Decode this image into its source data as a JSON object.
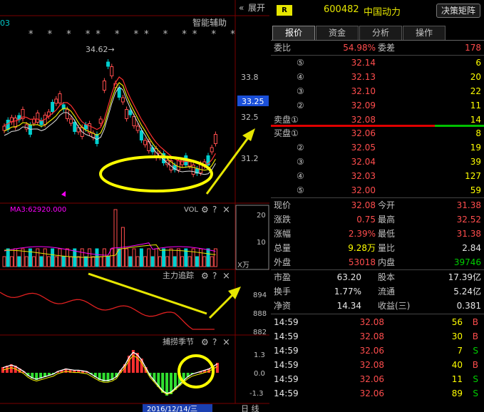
{
  "top_bar": {
    "code_suffix": "03",
    "expand_label": "展开",
    "expand_icon": "chevrons-left-icon",
    "assist_label": "智能辅助"
  },
  "price_chart": {
    "stars": "* * * ** * ** * ** * *",
    "high_annotation": "34.62→",
    "axis_labels": [
      "33.8",
      "32.5",
      "31.2"
    ],
    "current_price_tag": "33.25"
  },
  "vol_panel": {
    "ma_label": "MA3:62920.000",
    "title": "VOL",
    "axis_labels": [
      "20",
      "10"
    ],
    "unit": "X万"
  },
  "main_track_panel": {
    "title": "主力追踪",
    "axis_labels": [
      "894",
      "888",
      "882"
    ]
  },
  "season_panel": {
    "title": "捕捞季节",
    "axis_labels": [
      "1.3",
      "0.0",
      "-1.3"
    ]
  },
  "bottom_bar": {
    "date": "2016/12/14/三",
    "period": "日 线"
  },
  "panel_icons": {
    "settings": "gear-icon",
    "help": "?",
    "close": "×"
  },
  "stock": {
    "badge": "R",
    "code": "600482",
    "name": "中国动力",
    "matrix_button": "决策矩阵"
  },
  "tabs": [
    "报价",
    "资金",
    "分析",
    "操作"
  ],
  "order_ratio": {
    "label1": "委比",
    "value1": "54.98%",
    "label2": "委差",
    "value2": "178"
  },
  "sell_orders": [
    {
      "label": "⑤",
      "price": "32.14",
      "vol": "6"
    },
    {
      "label": "④",
      "price": "32.13",
      "vol": "20"
    },
    {
      "label": "③",
      "price": "32.10",
      "vol": "22"
    },
    {
      "label": "②",
      "price": "32.09",
      "vol": "11"
    },
    {
      "label": "卖盘①",
      "price": "32.08",
      "vol": "14"
    }
  ],
  "buy_orders": [
    {
      "label": "买盘①",
      "price": "32.06",
      "vol": "8"
    },
    {
      "label": "②",
      "price": "32.05",
      "vol": "19"
    },
    {
      "label": "③",
      "price": "32.04",
      "vol": "39"
    },
    {
      "label": "④",
      "price": "32.03",
      "vol": "127"
    },
    {
      "label": "⑤",
      "price": "32.00",
      "vol": "59"
    }
  ],
  "quote": [
    {
      "l1": "现价",
      "v1": "32.08",
      "c1": "red",
      "l2": "今开",
      "v2": "31.38",
      "c2": "red"
    },
    {
      "l1": "涨跌",
      "v1": "0.75",
      "c1": "red",
      "l2": "最高",
      "v2": "32.52",
      "c2": "red"
    },
    {
      "l1": "涨幅",
      "v1": "2.39%",
      "c1": "red",
      "l2": "最低",
      "v2": "31.38",
      "c2": "red"
    },
    {
      "l1": "总量",
      "v1": "9.28万",
      "c1": "yellow",
      "l2": "量比",
      "v2": "2.84",
      "c2": "white"
    },
    {
      "l1": "外盘",
      "v1": "53018",
      "c1": "red",
      "l2": "内盘",
      "v2": "39746",
      "c2": "green"
    }
  ],
  "fundamentals": [
    {
      "l1": "市盈",
      "v1": "63.20",
      "l2": "股本",
      "v2": "17.39亿"
    },
    {
      "l1": "换手",
      "v1": "1.77%",
      "l2": "流通",
      "v2": "5.24亿"
    },
    {
      "l1": "净资",
      "v1": "14.34",
      "l2": "收益(三)",
      "v2": "0.381"
    }
  ],
  "ticks": [
    {
      "time": "14:59",
      "price": "32.08",
      "vol": "56",
      "side": "B"
    },
    {
      "time": "14:59",
      "price": "32.08",
      "vol": "30",
      "side": "B"
    },
    {
      "time": "14:59",
      "price": "32.06",
      "vol": "7",
      "side": "S"
    },
    {
      "time": "14:59",
      "price": "32.08",
      "vol": "40",
      "side": "B"
    },
    {
      "time": "14:59",
      "price": "32.06",
      "vol": "11",
      "side": "S"
    },
    {
      "time": "14:59",
      "price": "32.06",
      "vol": "89",
      "side": "S"
    }
  ],
  "colors": {
    "up": "#ff4d4d",
    "down": "#00d0d0",
    "buy": "#ff3333",
    "sell": "#00d000",
    "highlight": "#ffff00"
  }
}
